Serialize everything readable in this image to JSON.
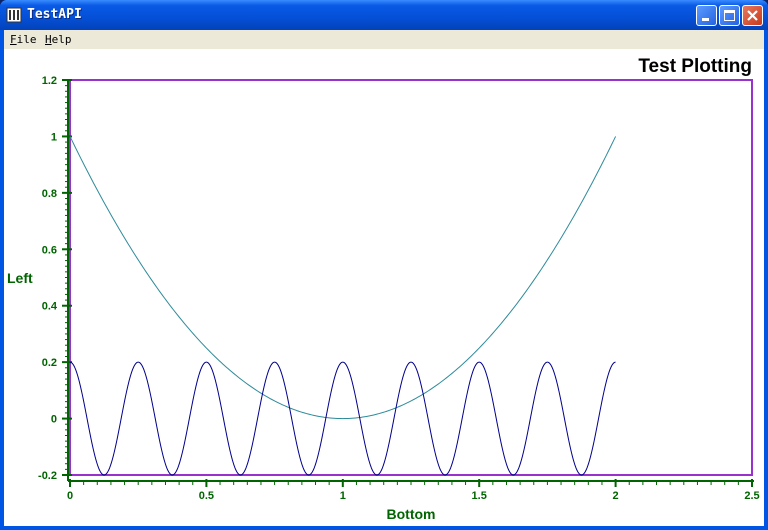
{
  "window": {
    "title": "TestAPI"
  },
  "menu": {
    "items": [
      {
        "label": "File",
        "accel": "F"
      },
      {
        "label": "Help",
        "accel": "H"
      }
    ]
  },
  "colors": {
    "axis": "#006400",
    "frame": "#9932cc",
    "parabola": "#2e8b9a",
    "sine": "#00008b",
    "title": "#000000"
  },
  "chart_data": {
    "type": "line",
    "title": "Test Plotting",
    "xlabel": "Bottom",
    "ylabel": "Left",
    "xlim": [
      0,
      2.5
    ],
    "ylim": [
      -0.2,
      1.2
    ],
    "xticks": [
      "0",
      "0.5",
      "1",
      "1.5",
      "2",
      "2.5"
    ],
    "yticks": [
      "-0.2",
      "0",
      "0.2",
      "0.4",
      "0.6",
      "0.8",
      "1",
      "1.2"
    ],
    "grid": false,
    "series": [
      {
        "formula": "y = (x - 1)^2",
        "x_range": [
          0,
          2
        ]
      },
      {
        "formula": "y = 0.2 * cos(8 * pi * x)",
        "x_range": [
          0,
          2
        ]
      }
    ]
  }
}
